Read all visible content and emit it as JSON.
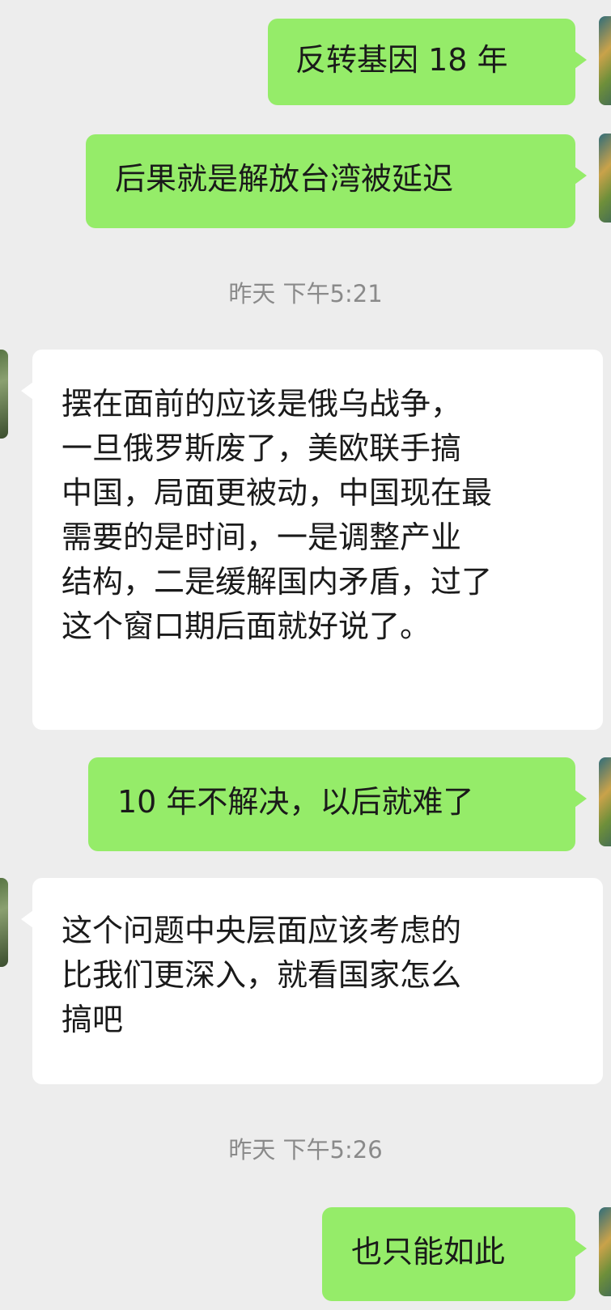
{
  "messages": [
    {
      "side": "out",
      "text": "反转基因 18 年"
    },
    {
      "side": "out",
      "text": "后果就是解放台湾被延迟"
    },
    {
      "type": "timestamp",
      "text": "昨天 下午5:21"
    },
    {
      "side": "in",
      "lines": [
        "摆在面前的应该是俄乌战争，",
        "一旦俄罗斯废了，美欧联手搞",
        "中国，局面更被动，中国现在最",
        "需要的是时间，一是调整产业",
        "结构，二是缓解国内矛盾，过了",
        "这个窗口期后面就好说了。"
      ]
    },
    {
      "side": "out",
      "text": "10 年不解决，以后就难了"
    },
    {
      "side": "in",
      "lines": [
        "这个问题中央层面应该考虑的",
        "比我们更深入，就看国家怎么",
        "搞吧"
      ]
    },
    {
      "type": "timestamp",
      "text": "昨天 下午5:26"
    },
    {
      "side": "out",
      "text": "也只能如此"
    }
  ],
  "colors": {
    "background": "#ededed",
    "outgoing_bubble": "#95ec69",
    "incoming_bubble": "#ffffff",
    "timestamp_text": "#8a8a8a"
  },
  "icons": {
    "avatar": "avatar-icon"
  }
}
